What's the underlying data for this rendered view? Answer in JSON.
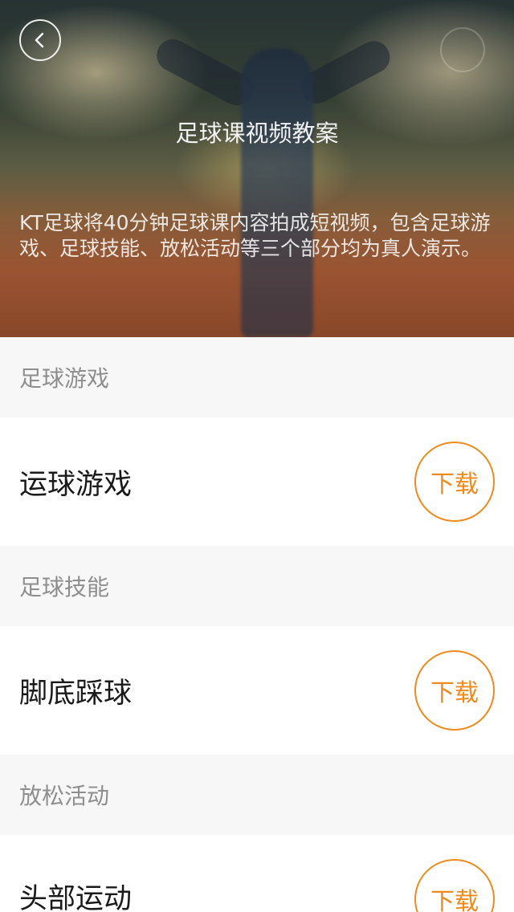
{
  "header": {
    "title": "足球课视频教案",
    "description": "KT足球将40分钟足球课内容拍成短视频，包含足球游戏、足球技能、放松活动等三个部分均为真人演示。",
    "back_icon": "chevron-left-icon"
  },
  "colors": {
    "accent": "#ee8a1e",
    "section_bg": "#f7f7f7",
    "section_text": "#8e8e8e",
    "item_text": "#1a1a1a"
  },
  "sections": [
    {
      "label": "足球游戏",
      "items": [
        {
          "title": "运球游戏",
          "action": "下载"
        }
      ]
    },
    {
      "label": "足球技能",
      "items": [
        {
          "title": "脚底踩球",
          "action": "下载"
        }
      ]
    },
    {
      "label": "放松活动",
      "items": [
        {
          "title": "头部运动",
          "action": "下载"
        }
      ]
    }
  ]
}
